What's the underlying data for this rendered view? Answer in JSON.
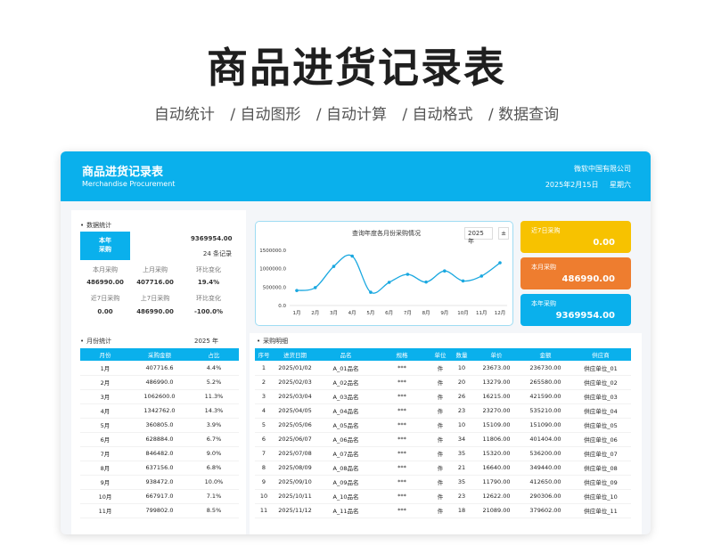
{
  "hero": {
    "title": "商品进货记录表",
    "features": [
      "自动统计",
      "/ 自动图形",
      "/ 自动计算",
      "/ 自动格式",
      "/ 数据查询"
    ]
  },
  "header": {
    "title": "商品进货记录表",
    "subtitle": "Merchandise  Procurement",
    "company": "微软中国有限公司",
    "date": "2025年2月15日",
    "weekday": "星期六"
  },
  "stats": {
    "section_title": "数据统计",
    "box_label_1": "本年",
    "box_label_2": "采购",
    "year_total": "9369954.00",
    "record_count": "24 条记录",
    "labels_1": [
      "本月采购",
      "上月采购",
      "环比变化"
    ],
    "values_1": [
      "486990.00",
      "407716.00",
      "19.4%"
    ],
    "labels_2": [
      "近7日采购",
      "上7日采购",
      "环比变化"
    ],
    "values_2": [
      "0.00",
      "486990.00",
      "-100.0%"
    ]
  },
  "kpis": [
    {
      "label": "近7日采购",
      "value": "0.00",
      "color": "#f7c200"
    },
    {
      "label": "本月采购",
      "value": "486990.00",
      "color": "#ee7d2f"
    },
    {
      "label": "本年采购",
      "value": "9369954.00",
      "color": "#0ab0ec"
    }
  ],
  "chart_data": {
    "type": "line",
    "title": "查询年度各月份采购情况",
    "year_select": "2025 年",
    "categories": [
      "1月",
      "2月",
      "3月",
      "4月",
      "5月",
      "6月",
      "7月",
      "8月",
      "9月",
      "10月",
      "11月",
      "12月"
    ],
    "values": [
      407716.6,
      486990.0,
      1062600.0,
      1342762.0,
      360805.0,
      628884.0,
      846482.0,
      637156.0,
      938472.0,
      667917.0,
      799802.0,
      1160000.0
    ],
    "ylim": [
      0,
      1500000
    ],
    "yticks": [
      "0.0",
      "500000.0",
      "1000000.0",
      "1500000.0"
    ],
    "color": "#1aa8e0"
  },
  "monthly": {
    "section_title": "月份统计",
    "year": "2025 年",
    "headers": [
      "月份",
      "采购金额",
      "占比"
    ],
    "rows": [
      [
        "1月",
        "407716.6",
        "4.4%"
      ],
      [
        "2月",
        "486990.0",
        "5.2%"
      ],
      [
        "3月",
        "1062600.0",
        "11.3%"
      ],
      [
        "4月",
        "1342762.0",
        "14.3%"
      ],
      [
        "5月",
        "360805.0",
        "3.9%"
      ],
      [
        "6月",
        "628884.0",
        "6.7%"
      ],
      [
        "7月",
        "846482.0",
        "9.0%"
      ],
      [
        "8月",
        "637156.0",
        "6.8%"
      ],
      [
        "9月",
        "938472.0",
        "10.0%"
      ],
      [
        "10月",
        "667917.0",
        "7.1%"
      ],
      [
        "11月",
        "799802.0",
        "8.5%"
      ]
    ]
  },
  "detail": {
    "section_title": "采购明细",
    "headers": [
      "序号",
      "进货日期",
      "品名",
      "规格",
      "单位",
      "数量",
      "单价",
      "金额",
      "供应商"
    ],
    "rows": [
      [
        "1",
        "2025/01/02",
        "A_01品名",
        "***",
        "件",
        "10",
        "23673.00",
        "236730.00",
        "供应单位_01"
      ],
      [
        "2",
        "2025/02/03",
        "A_02品名",
        "***",
        "件",
        "20",
        "13279.00",
        "265580.00",
        "供应单位_02"
      ],
      [
        "3",
        "2025/03/04",
        "A_03品名",
        "***",
        "件",
        "26",
        "16215.00",
        "421590.00",
        "供应单位_03"
      ],
      [
        "4",
        "2025/04/05",
        "A_04品名",
        "***",
        "件",
        "23",
        "23270.00",
        "535210.00",
        "供应单位_04"
      ],
      [
        "5",
        "2025/05/06",
        "A_05品名",
        "***",
        "件",
        "10",
        "15109.00",
        "151090.00",
        "供应单位_05"
      ],
      [
        "6",
        "2025/06/07",
        "A_06品名",
        "***",
        "件",
        "34",
        "11806.00",
        "401404.00",
        "供应单位_06"
      ],
      [
        "7",
        "2025/07/08",
        "A_07品名",
        "***",
        "件",
        "35",
        "15320.00",
        "536200.00",
        "供应单位_07"
      ],
      [
        "8",
        "2025/08/09",
        "A_08品名",
        "***",
        "件",
        "21",
        "16640.00",
        "349440.00",
        "供应单位_08"
      ],
      [
        "9",
        "2025/09/10",
        "A_09品名",
        "***",
        "件",
        "35",
        "11790.00",
        "412650.00",
        "供应单位_09"
      ],
      [
        "10",
        "2025/10/11",
        "A_10品名",
        "***",
        "件",
        "23",
        "12622.00",
        "290306.00",
        "供应单位_10"
      ],
      [
        "11",
        "2025/11/12",
        "A_11品名",
        "***",
        "件",
        "18",
        "21089.00",
        "379602.00",
        "供应单位_11"
      ]
    ]
  }
}
